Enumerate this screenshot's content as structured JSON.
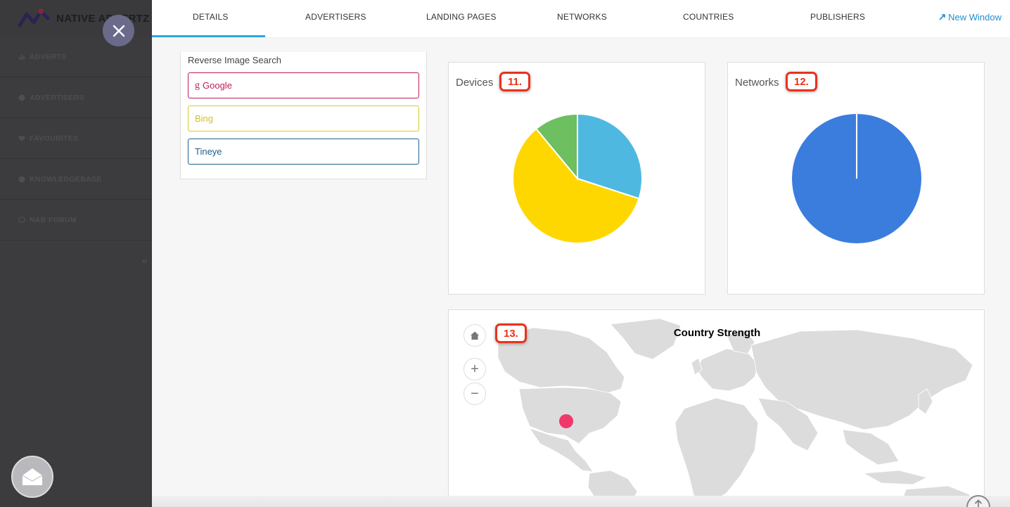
{
  "sidebar": {
    "brand": "NATIVE ADVERTZ",
    "items": [
      {
        "label": "ADVERTS",
        "icon": "bar-chart-icon"
      },
      {
        "label": "ADVERTISERS",
        "icon": "globe-icon"
      },
      {
        "label": "FAVOURITES",
        "icon": "heart-icon"
      },
      {
        "label": "KNOWLEDGEBASE",
        "icon": "question-icon"
      },
      {
        "label": "NAB FORUM",
        "icon": "chat-bubble-icon"
      }
    ],
    "collapse_glyph": "«"
  },
  "tabs": [
    {
      "label": "DETAILS",
      "active": true
    },
    {
      "label": "ADVERTISERS"
    },
    {
      "label": "LANDING PAGES"
    },
    {
      "label": "NETWORKS"
    },
    {
      "label": "COUNTRIES"
    },
    {
      "label": "PUBLISHERS"
    }
  ],
  "new_window": "New Window",
  "reverse_search": {
    "title": "Reverse Image Search",
    "google": "Google",
    "bing": "Bing",
    "tineye": "Tineye"
  },
  "devices": {
    "title": "Devices",
    "badge": "11.",
    "slices": [
      {
        "value": 30,
        "color": "#4fb8e0"
      },
      {
        "value": 59,
        "color": "#ffd700"
      },
      {
        "value": 11,
        "color": "#6dbf5f"
      }
    ]
  },
  "networks": {
    "title": "Networks",
    "badge": "12.",
    "slices": [
      {
        "value": 100,
        "color": "#3b7ddd"
      }
    ]
  },
  "map": {
    "title": "Country Strength",
    "badge": "13.",
    "home_icon": "home-icon",
    "zoom_in": "+",
    "zoom_out": "−",
    "marker_color": "#f0386b"
  },
  "colors": {
    "accent": "#2aa8e0",
    "badge_red": "#e8321c",
    "google": "#c2185b",
    "bing": "#cfc22a",
    "tineye": "#1f5f8b"
  }
}
